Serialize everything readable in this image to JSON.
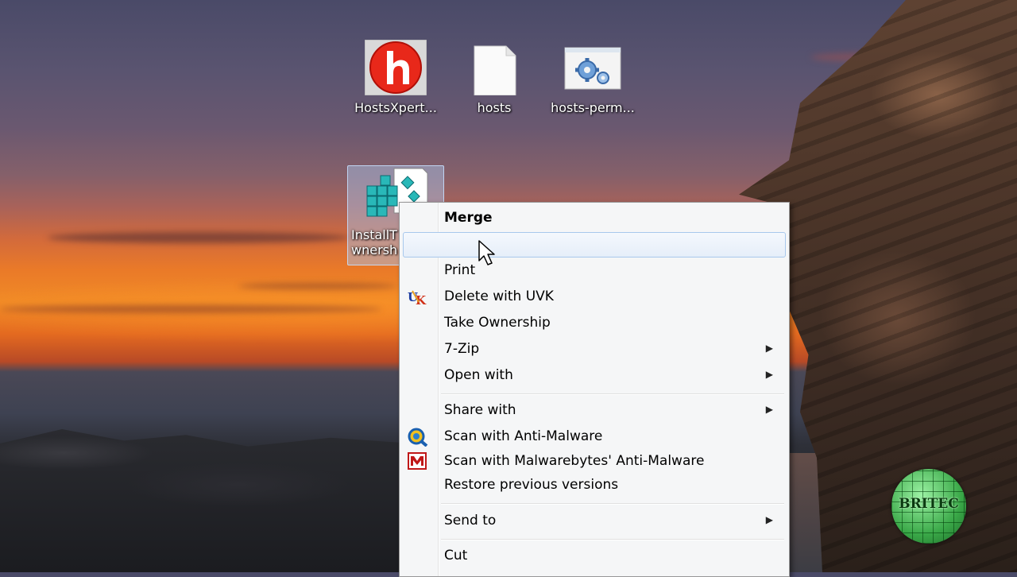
{
  "desktop": {
    "icons": [
      {
        "label": "HostsXpert..."
      },
      {
        "label": "hosts"
      },
      {
        "label": "hosts-perm..."
      },
      {
        "label_line1": "InstallT",
        "label_line2": "wnersh"
      }
    ]
  },
  "context_menu": {
    "items": [
      {
        "label": "Merge",
        "bold": true
      },
      {
        "label": ""
      },
      {
        "label": "Print"
      },
      {
        "label": "Delete with UVK",
        "icon": "uvk-icon"
      },
      {
        "label": "Take Ownership"
      },
      {
        "label": "7-Zip",
        "submenu": true
      },
      {
        "label": "Open with",
        "submenu": true
      },
      {
        "label": "Share with",
        "submenu": true
      },
      {
        "label": "Scan with Anti-Malware",
        "icon": "anti-malware-icon"
      },
      {
        "label": "Scan with Malwarebytes' Anti-Malware",
        "icon": "malwarebytes-icon"
      },
      {
        "label": "Restore previous versions"
      },
      {
        "label": "Send to",
        "submenu": true
      },
      {
        "label": "Cut"
      }
    ],
    "submenu_arrow": "▶"
  },
  "watermark": {
    "text": "BRITEC"
  },
  "colors": {
    "highlight_border": "#a8c8ec",
    "menu_bg": "#f5f6f7"
  }
}
